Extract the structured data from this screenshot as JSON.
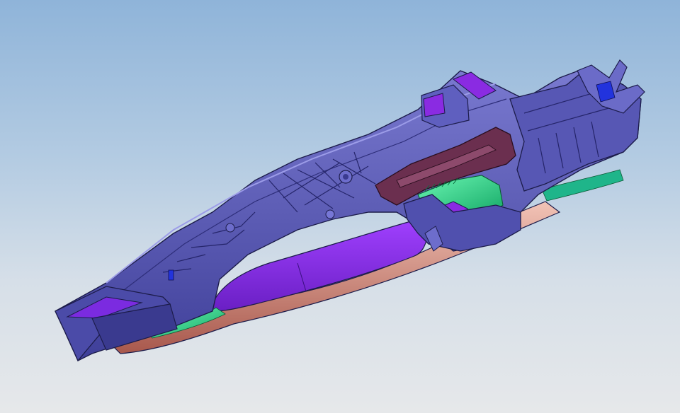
{
  "viewport": {
    "background_top": "#8fb4d9",
    "background_bottom": "#e6e8ea"
  },
  "model": {
    "colors": {
      "housing": "#5a5ab8",
      "housing_dark": "#2e2e7a",
      "housing_light": "#8888dd",
      "edges": "#1c1c4a",
      "handle_purple": "#8a2be2",
      "handle_copper": "#d88a78",
      "bracket_maroon": "#6b2f4f",
      "spring_green": "#27e08a",
      "accent_blue": "#2233dd"
    }
  }
}
